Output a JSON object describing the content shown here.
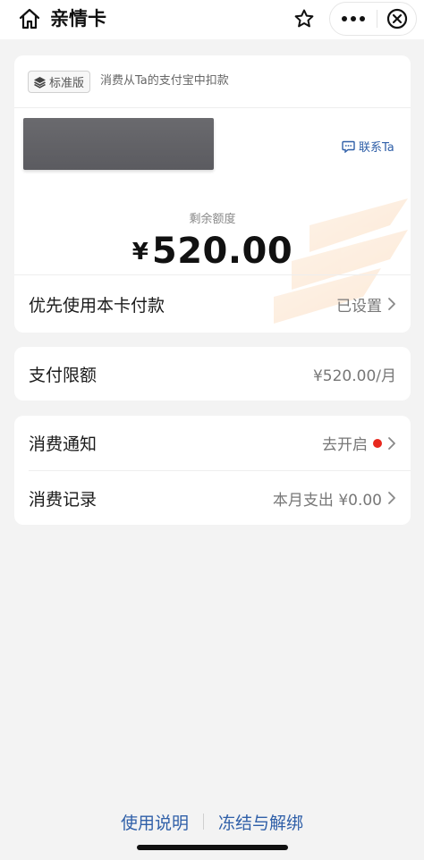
{
  "header": {
    "title": "亲情卡",
    "icons": {
      "home": "home-icon",
      "star": "star-icon",
      "more": "more-dots-icon",
      "close": "close-circle-icon"
    }
  },
  "card": {
    "badge_label": "标准版",
    "badge_desc": "消费从Ta的支付宝中扣款",
    "contact_label": "联系Ta",
    "remaining_label": "剩余额度",
    "currency": "¥",
    "amount": "520.00",
    "priority_label": "优先使用本卡付款",
    "priority_value": "已设置"
  },
  "limit": {
    "label": "支付限额",
    "value": "¥520.00/月"
  },
  "notify": {
    "label": "消费通知",
    "value": "去开启"
  },
  "records": {
    "label": "消费记录",
    "value": "本月支出 ¥0.00"
  },
  "footer": {
    "help_label": "使用说明",
    "freeze_label": "冻结与解绑"
  },
  "colors": {
    "accent": "#2f5fa8",
    "alert_dot": "#e8281e",
    "background": "#f3f3f3"
  }
}
